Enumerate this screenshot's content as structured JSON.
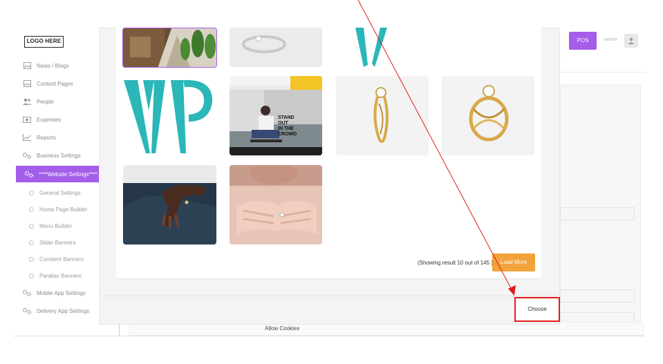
{
  "sidebar": {
    "logo": "LOGO HERE",
    "items": [
      {
        "label": "News / Blogs",
        "icon": "image-icon"
      },
      {
        "label": "Content Pages",
        "icon": "image-icon"
      },
      {
        "label": "People",
        "icon": "users-icon"
      },
      {
        "label": "Expenses",
        "icon": "money-icon"
      },
      {
        "label": "Reports",
        "icon": "chart-line-icon"
      },
      {
        "label": "Business Settings",
        "icon": "gears-icon"
      },
      {
        "label": "****Website Settings****",
        "icon": "gears-icon",
        "active": true
      }
    ],
    "subitems": [
      "General Settings",
      "Home Page Builder",
      "Menu Builder",
      "Slider Banners",
      "Constent Banners",
      "Parallax Banners"
    ],
    "bottom_items": [
      {
        "label": "Mobile App Settings",
        "icon": "gears-icon"
      },
      {
        "label": "Delivery App Settings",
        "icon": "gears-icon"
      }
    ]
  },
  "header": {
    "pos_label": "POS",
    "user_name": "owner"
  },
  "background": {
    "allow_cookies_label": "Allow Cookies"
  },
  "gallery": {
    "images": [
      {
        "name": "garden-house-image"
      },
      {
        "name": "diamond-ring-closeup-image"
      },
      {
        "name": "wp-logo-partial-image"
      },
      {
        "name": "wp-logo-image"
      },
      {
        "name": "stand-out-poster-image"
      },
      {
        "name": "gold-ring-side-image"
      },
      {
        "name": "gold-twist-ring-image"
      },
      {
        "name": "hand-ring-image"
      },
      {
        "name": "hands-ring-image"
      }
    ],
    "poster_text": "STAND OUT IN THE CROWD",
    "status": "(Showing result 10 out of 145 )",
    "load_more_label": "Load More"
  },
  "modal": {
    "choose_label": "Choose"
  },
  "colors": {
    "accent": "#a45ee9",
    "load_more": "#f2a23a",
    "highlight": "#e11b1b",
    "teal": "#2bb6b8",
    "gold": "#d9a84a"
  }
}
